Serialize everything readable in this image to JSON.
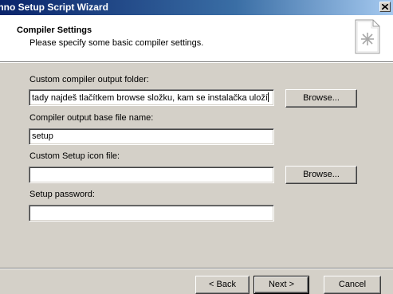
{
  "window": {
    "title": "Inno Setup Script Wizard"
  },
  "header": {
    "title": "Compiler Settings",
    "subtitle": "Please specify some basic compiler settings.",
    "icon": "wizard-page-icon"
  },
  "form": {
    "output_folder": {
      "label": "Custom compiler output folder:",
      "value": "tady najdeš tlačítkem browse složku, kam se instalačka uloží",
      "browse_label": "Browse..."
    },
    "base_file_name": {
      "label": "Compiler output base file name:",
      "value": "setup"
    },
    "icon_file": {
      "label": "Custom Setup icon file:",
      "value": "",
      "browse_label": "Browse..."
    },
    "password": {
      "label": "Setup password:",
      "value": ""
    }
  },
  "footer": {
    "back_label": "< Back",
    "next_label": "Next >",
    "cancel_label": "Cancel"
  },
  "colors": {
    "dialog_background": "#d4d0c8",
    "title_bar_start": "#0a246a",
    "title_bar_end": "#a6caf0",
    "header_background": "#ffffff"
  }
}
